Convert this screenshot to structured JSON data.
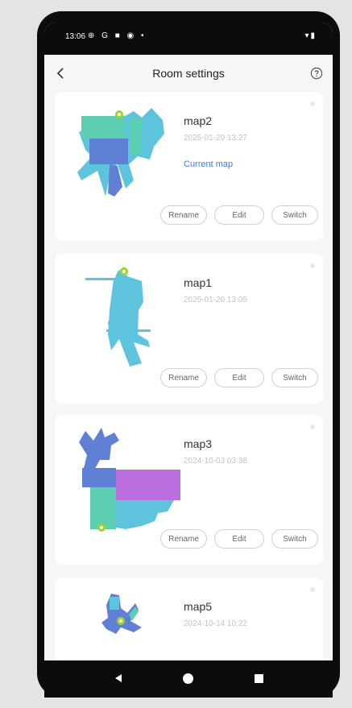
{
  "status_bar": {
    "time": "13:06",
    "icons_left": "⊕ G ■ ◉ •",
    "icons_right": "▾▮"
  },
  "header": {
    "title": "Room settings"
  },
  "maps": [
    {
      "name": "map2",
      "date": "2025-01-20 13:27",
      "current_label": "Current map",
      "rename": "Rename",
      "edit": "Edit",
      "switch": "Switch"
    },
    {
      "name": "map1",
      "date": "2025-01-20 13:05",
      "rename": "Rename",
      "edit": "Edit",
      "switch": "Switch"
    },
    {
      "name": "map3",
      "date": "2024-10-03 03:38",
      "rename": "Rename",
      "edit": "Edit",
      "switch": "Switch"
    },
    {
      "name": "map5",
      "date": "2024-10-14 10:22"
    }
  ],
  "colors": {
    "teal": "#5ccfb0",
    "blue": "#5f80d4",
    "cyan": "#5ec4de",
    "purple": "#bb6fde",
    "dock": "#9bd62b",
    "link": "#3d7cf0"
  },
  "icons": {
    "back": "chevron-left-icon",
    "help": "help-circle-icon"
  }
}
